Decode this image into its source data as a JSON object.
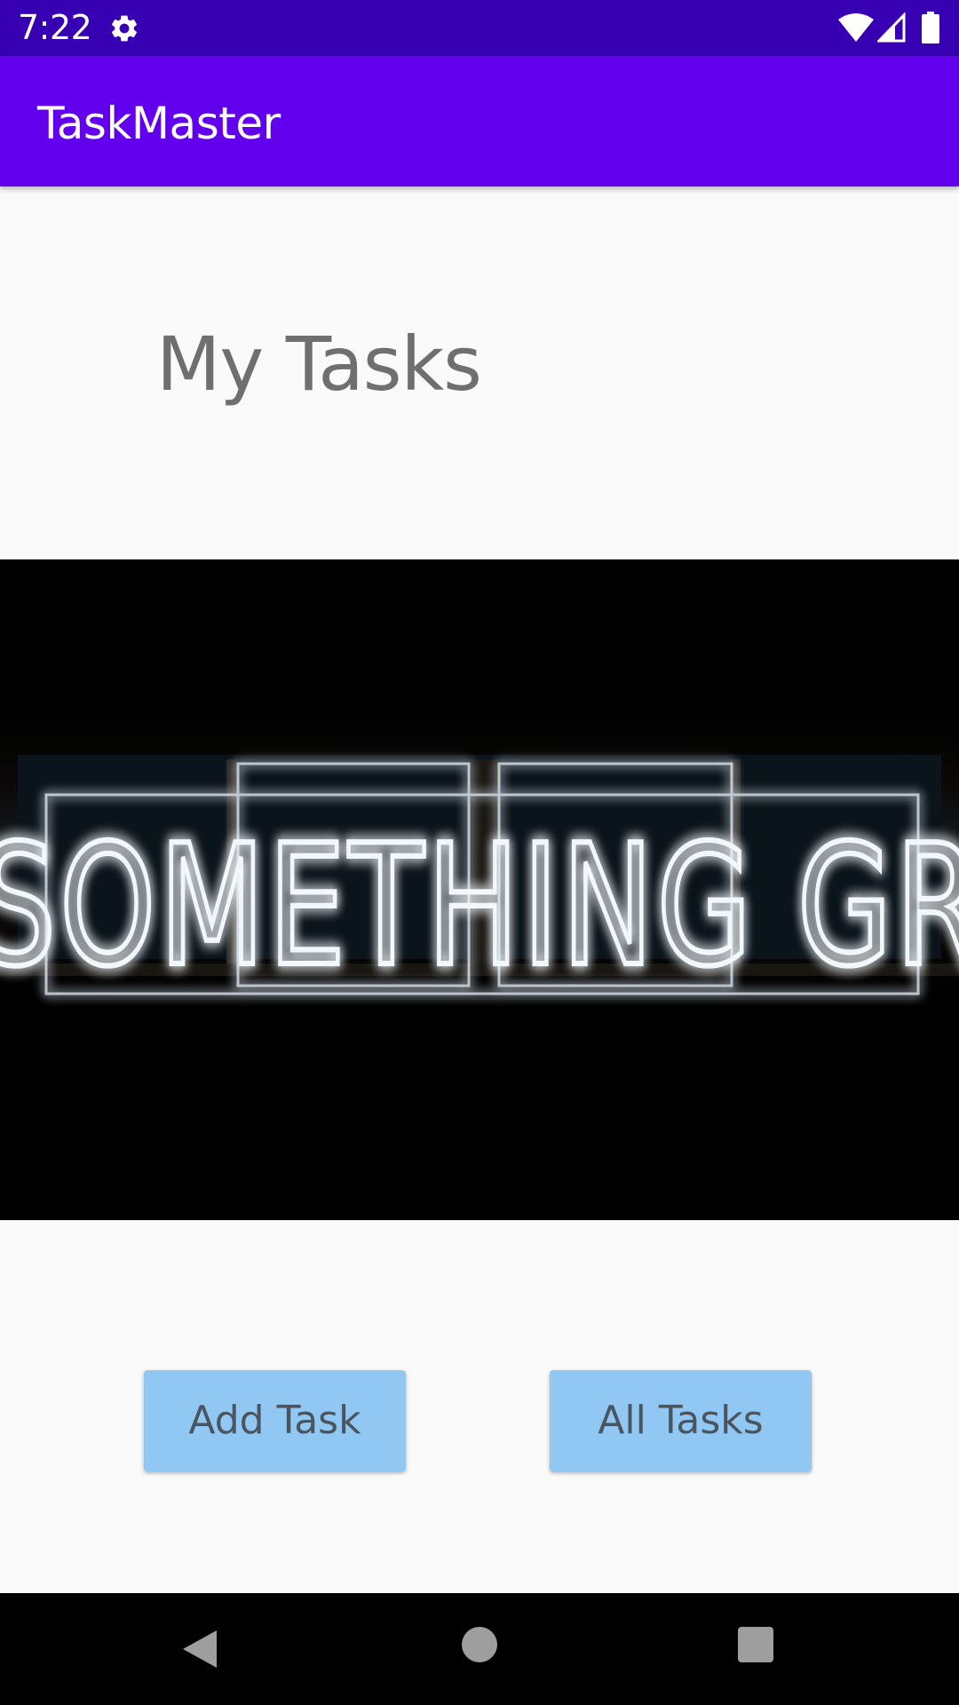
{
  "status_bar": {
    "time": "7:22",
    "icons": [
      "gear-icon",
      "wifi-icon",
      "signal-icon",
      "battery-icon"
    ],
    "background": "#3700b3"
  },
  "app_bar": {
    "title": "TaskMaster",
    "background": "#6200ee"
  },
  "main": {
    "heading": "My Tasks",
    "hero_image": {
      "description": "neon sign",
      "sign_text": "DO SOMETHING GREAT"
    },
    "buttons": {
      "add_task": "Add Task",
      "all_tasks": "All Tasks",
      "color": "#90c8f3"
    }
  },
  "nav_bar": {
    "icons": [
      "back-icon",
      "home-icon",
      "recents-icon"
    ]
  }
}
